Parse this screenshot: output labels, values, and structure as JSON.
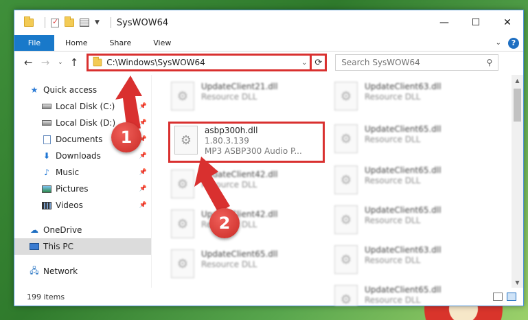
{
  "window": {
    "title": "SysWOW64",
    "controls": {
      "minimize": "—",
      "maximize": "☐",
      "close": "✕"
    }
  },
  "ribbon": {
    "tabs": [
      "File",
      "Home",
      "Share",
      "View"
    ],
    "expand_chevron": "⌄",
    "help": "?"
  },
  "nav": {
    "back": "←",
    "forward": "→",
    "recent": "⌄",
    "up": "↑",
    "address": "C:\\Windows\\SysWOW64",
    "refresh": "⟳",
    "search_placeholder": "Search SysWOW64"
  },
  "sidebar": {
    "items": [
      {
        "label": "Quick access",
        "icon": "star-icon"
      },
      {
        "label": "Local Disk (C:)",
        "icon": "disk-icon",
        "pinned": true
      },
      {
        "label": "Local Disk (D:)",
        "icon": "disk-icon",
        "pinned": true
      },
      {
        "label": "Documents",
        "icon": "documents-icon",
        "pinned": true
      },
      {
        "label": "Downloads",
        "icon": "download-icon",
        "pinned": true
      },
      {
        "label": "Music",
        "icon": "music-icon",
        "pinned": true
      },
      {
        "label": "Pictures",
        "icon": "pictures-icon",
        "pinned": true
      },
      {
        "label": "Videos",
        "icon": "videos-icon",
        "pinned": true
      },
      {
        "label": "OneDrive",
        "icon": "cloud-icon"
      },
      {
        "label": "This PC",
        "icon": "computer-icon",
        "selected": true
      },
      {
        "label": "Network",
        "icon": "network-icon"
      }
    ]
  },
  "files": {
    "highlighted": {
      "name": "asbp300h.dll",
      "version": "1.80.3.139",
      "description": "MP3 ASBP300 Audio P..."
    },
    "col1": [
      {
        "name": "UpdateClient21.dll",
        "type": "Resource DLL"
      },
      {
        "name": "UpdateClient42.dll",
        "type": "Resource DLL"
      },
      {
        "name": "UpdateClient42.dll",
        "type": "Resource DLL"
      },
      {
        "name": "UpdateClient65.dll",
        "type": "Resource DLL"
      }
    ],
    "col2": [
      {
        "name": "UpdateClient63.dll",
        "type": "Resource DLL"
      },
      {
        "name": "UpdateClient65.dll",
        "type": "Resource DLL"
      },
      {
        "name": "UpdateClient65.dll",
        "type": "Resource DLL"
      },
      {
        "name": "UpdateClient65.dll",
        "type": "Resource DLL"
      },
      {
        "name": "UpdateClient63.dll",
        "type": "Resource DLL"
      },
      {
        "name": "UpdateClient65.dll",
        "type": "Resource DLL"
      }
    ]
  },
  "status": {
    "item_count": "199 items"
  },
  "callouts": [
    "1",
    "2"
  ],
  "colors": {
    "accent": "#1979ca",
    "highlight": "#d9302f"
  }
}
